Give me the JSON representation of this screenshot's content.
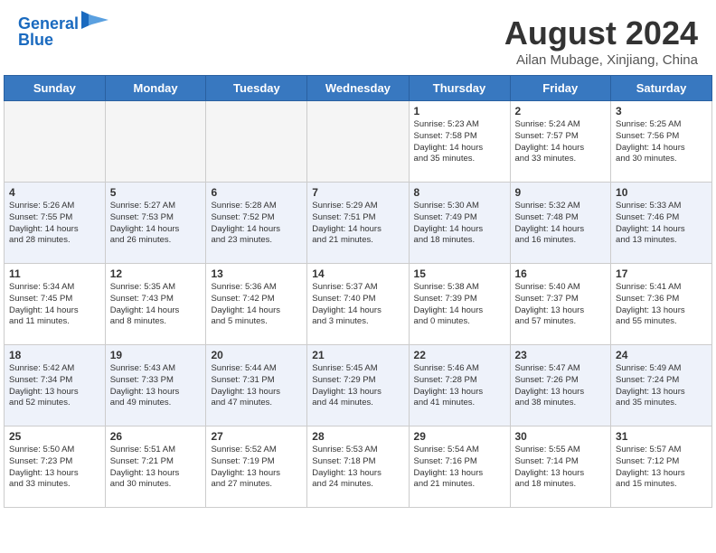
{
  "header": {
    "logo_line1": "General",
    "logo_line2": "Blue",
    "main_title": "August 2024",
    "sub_title": "Ailan Mubage, Xinjiang, China"
  },
  "days_of_week": [
    "Sunday",
    "Monday",
    "Tuesday",
    "Wednesday",
    "Thursday",
    "Friday",
    "Saturday"
  ],
  "weeks": [
    [
      {
        "day": "",
        "info": ""
      },
      {
        "day": "",
        "info": ""
      },
      {
        "day": "",
        "info": ""
      },
      {
        "day": "",
        "info": ""
      },
      {
        "day": "1",
        "info": "Sunrise: 5:23 AM\nSunset: 7:58 PM\nDaylight: 14 hours\nand 35 minutes."
      },
      {
        "day": "2",
        "info": "Sunrise: 5:24 AM\nSunset: 7:57 PM\nDaylight: 14 hours\nand 33 minutes."
      },
      {
        "day": "3",
        "info": "Sunrise: 5:25 AM\nSunset: 7:56 PM\nDaylight: 14 hours\nand 30 minutes."
      }
    ],
    [
      {
        "day": "4",
        "info": "Sunrise: 5:26 AM\nSunset: 7:55 PM\nDaylight: 14 hours\nand 28 minutes."
      },
      {
        "day": "5",
        "info": "Sunrise: 5:27 AM\nSunset: 7:53 PM\nDaylight: 14 hours\nand 26 minutes."
      },
      {
        "day": "6",
        "info": "Sunrise: 5:28 AM\nSunset: 7:52 PM\nDaylight: 14 hours\nand 23 minutes."
      },
      {
        "day": "7",
        "info": "Sunrise: 5:29 AM\nSunset: 7:51 PM\nDaylight: 14 hours\nand 21 minutes."
      },
      {
        "day": "8",
        "info": "Sunrise: 5:30 AM\nSunset: 7:49 PM\nDaylight: 14 hours\nand 18 minutes."
      },
      {
        "day": "9",
        "info": "Sunrise: 5:32 AM\nSunset: 7:48 PM\nDaylight: 14 hours\nand 16 minutes."
      },
      {
        "day": "10",
        "info": "Sunrise: 5:33 AM\nSunset: 7:46 PM\nDaylight: 14 hours\nand 13 minutes."
      }
    ],
    [
      {
        "day": "11",
        "info": "Sunrise: 5:34 AM\nSunset: 7:45 PM\nDaylight: 14 hours\nand 11 minutes."
      },
      {
        "day": "12",
        "info": "Sunrise: 5:35 AM\nSunset: 7:43 PM\nDaylight: 14 hours\nand 8 minutes."
      },
      {
        "day": "13",
        "info": "Sunrise: 5:36 AM\nSunset: 7:42 PM\nDaylight: 14 hours\nand 5 minutes."
      },
      {
        "day": "14",
        "info": "Sunrise: 5:37 AM\nSunset: 7:40 PM\nDaylight: 14 hours\nand 3 minutes."
      },
      {
        "day": "15",
        "info": "Sunrise: 5:38 AM\nSunset: 7:39 PM\nDaylight: 14 hours\nand 0 minutes."
      },
      {
        "day": "16",
        "info": "Sunrise: 5:40 AM\nSunset: 7:37 PM\nDaylight: 13 hours\nand 57 minutes."
      },
      {
        "day": "17",
        "info": "Sunrise: 5:41 AM\nSunset: 7:36 PM\nDaylight: 13 hours\nand 55 minutes."
      }
    ],
    [
      {
        "day": "18",
        "info": "Sunrise: 5:42 AM\nSunset: 7:34 PM\nDaylight: 13 hours\nand 52 minutes."
      },
      {
        "day": "19",
        "info": "Sunrise: 5:43 AM\nSunset: 7:33 PM\nDaylight: 13 hours\nand 49 minutes."
      },
      {
        "day": "20",
        "info": "Sunrise: 5:44 AM\nSunset: 7:31 PM\nDaylight: 13 hours\nand 47 minutes."
      },
      {
        "day": "21",
        "info": "Sunrise: 5:45 AM\nSunset: 7:29 PM\nDaylight: 13 hours\nand 44 minutes."
      },
      {
        "day": "22",
        "info": "Sunrise: 5:46 AM\nSunset: 7:28 PM\nDaylight: 13 hours\nand 41 minutes."
      },
      {
        "day": "23",
        "info": "Sunrise: 5:47 AM\nSunset: 7:26 PM\nDaylight: 13 hours\nand 38 minutes."
      },
      {
        "day": "24",
        "info": "Sunrise: 5:49 AM\nSunset: 7:24 PM\nDaylight: 13 hours\nand 35 minutes."
      }
    ],
    [
      {
        "day": "25",
        "info": "Sunrise: 5:50 AM\nSunset: 7:23 PM\nDaylight: 13 hours\nand 33 minutes."
      },
      {
        "day": "26",
        "info": "Sunrise: 5:51 AM\nSunset: 7:21 PM\nDaylight: 13 hours\nand 30 minutes."
      },
      {
        "day": "27",
        "info": "Sunrise: 5:52 AM\nSunset: 7:19 PM\nDaylight: 13 hours\nand 27 minutes."
      },
      {
        "day": "28",
        "info": "Sunrise: 5:53 AM\nSunset: 7:18 PM\nDaylight: 13 hours\nand 24 minutes."
      },
      {
        "day": "29",
        "info": "Sunrise: 5:54 AM\nSunset: 7:16 PM\nDaylight: 13 hours\nand 21 minutes."
      },
      {
        "day": "30",
        "info": "Sunrise: 5:55 AM\nSunset: 7:14 PM\nDaylight: 13 hours\nand 18 minutes."
      },
      {
        "day": "31",
        "info": "Sunrise: 5:57 AM\nSunset: 7:12 PM\nDaylight: 13 hours\nand 15 minutes."
      }
    ]
  ]
}
